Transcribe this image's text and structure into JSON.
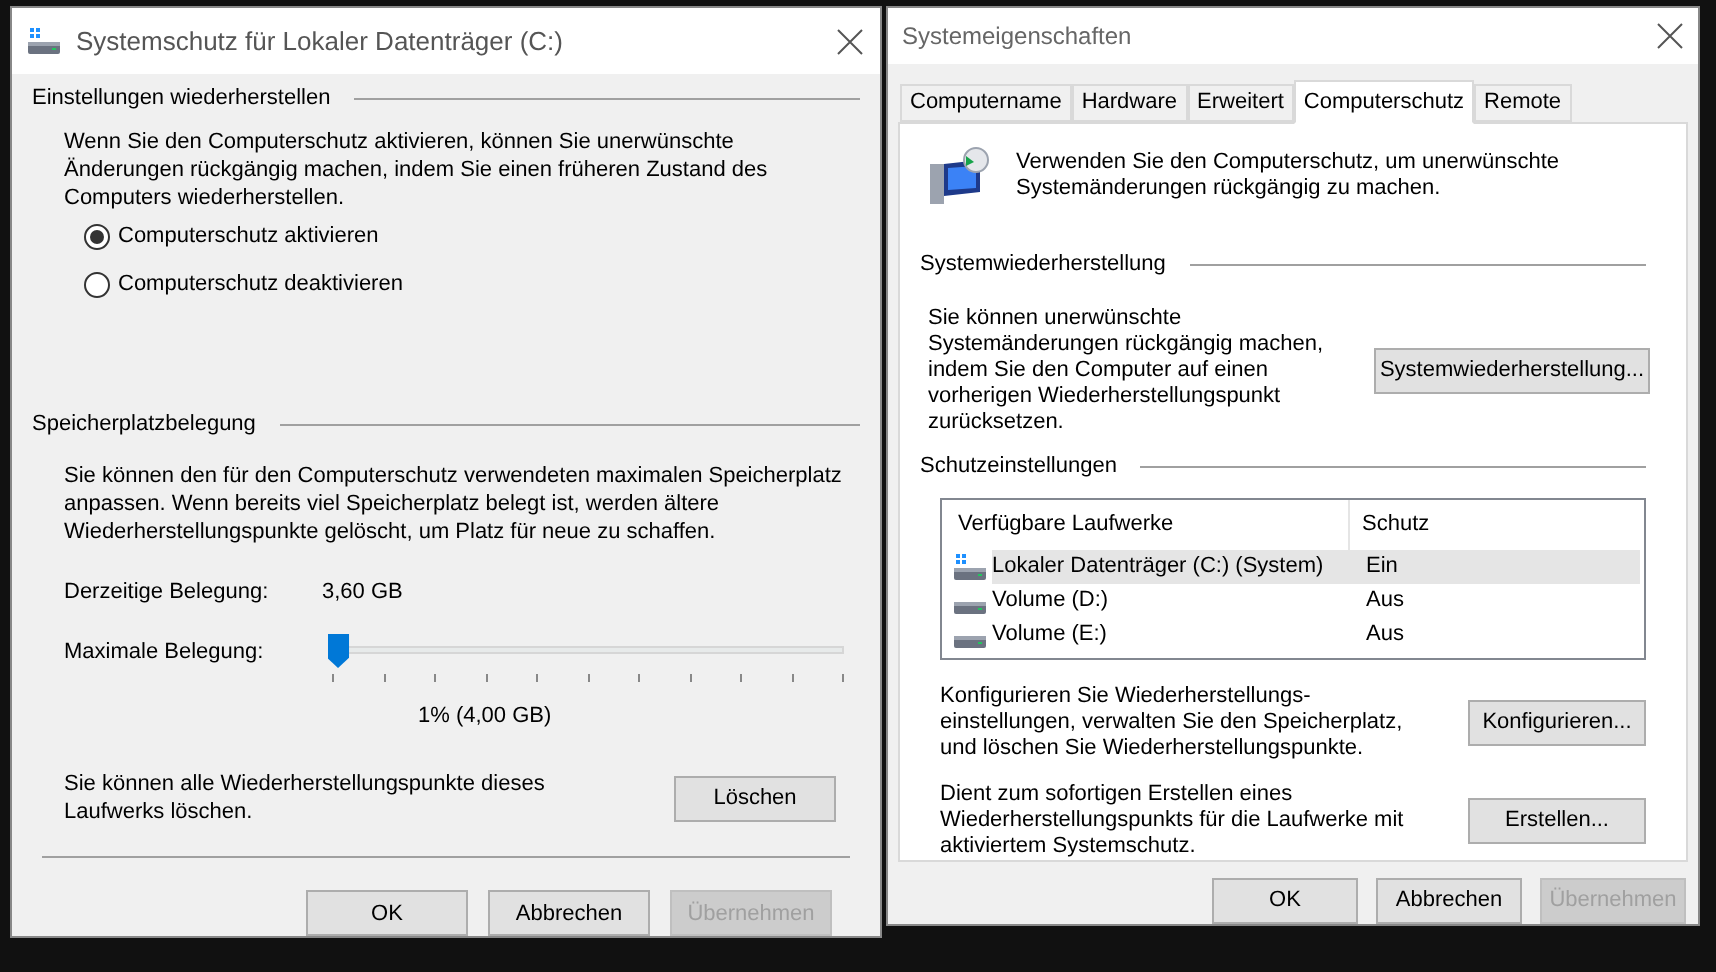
{
  "left_window": {
    "title": "Systemschutz für Lokaler Datenträger (C:)",
    "restore_section": {
      "heading": "Einstellungen wiederherstellen",
      "description": "Wenn Sie den Computerschutz aktivieren, können Sie unerwünschte Änderungen rückgängig machen, indem Sie einen früheren Zustand des Computers wiederherstellen.",
      "options": [
        {
          "label": "Computerschutz aktivieren",
          "selected": true
        },
        {
          "label": "Computerschutz deaktivieren",
          "selected": false
        }
      ]
    },
    "usage_section": {
      "heading": "Speicherplatzbelegung",
      "description": "Sie können den für den Computerschutz verwendeten maximalen Speicherplatz anpassen. Wenn bereits viel Speicherplatz belegt ist, werden ältere Wiederherstellungspunkte gelöscht, um Platz für neue zu schaffen.",
      "current_label": "Derzeitige Belegung:",
      "current_value": "3,60 GB",
      "max_label": "Maximale Belegung:",
      "slider": {
        "level": 0.01
      },
      "slider_reading": "1% (4,00 GB)",
      "delete_text": "Sie können alle Wiederherstellungspunkte dieses Laufwerks löschen.",
      "delete_button": "Löschen"
    },
    "buttons": [
      {
        "label": "OK",
        "disabled": false
      },
      {
        "label": "Abbrechen",
        "disabled": false
      },
      {
        "label": "Übernehmen",
        "disabled": true
      }
    ]
  },
  "right_window": {
    "title": "Systemeigenschaften",
    "tabs": [
      {
        "label": "Computername",
        "selected": false
      },
      {
        "label": "Hardware",
        "selected": false
      },
      {
        "label": "Erweitert",
        "selected": false
      },
      {
        "label": "Computerschutz",
        "selected": true
      },
      {
        "label": "Remote",
        "selected": false
      }
    ],
    "intro": "Verwenden Sie den Computerschutz, um unerwünschte Systemänderungen rückgängig zu machen.",
    "restore_section": {
      "heading": "Systemwiederherstellung",
      "description": "Sie können unerwünschte Systemänderungen rückgängig machen, indem Sie den Computer auf einen vorherigen Wiederherstellungspunkt zurücksetzen.",
      "button": "Systemwiederherstellung..."
    },
    "protection_section": {
      "heading": "Schutzeinstellungen",
      "columns": [
        "Verfügbare Laufwerke",
        "Schutz"
      ],
      "rows": [
        {
          "kind": "system",
          "drive": "Lokaler Datenträger (C:) (System)",
          "protection": "Ein",
          "selected": true
        },
        {
          "kind": "volume",
          "drive": "Volume (D:)",
          "protection": "Aus",
          "selected": false
        },
        {
          "kind": "volume",
          "drive": "Volume (E:)",
          "protection": "Aus",
          "selected": false
        }
      ],
      "configure_text": "Konfigurieren Sie Wiederherstellungs-einstellungen, verwalten Sie den Speicherplatz, und löschen Sie Wiederherstellungspunkte.",
      "configure_button": "Konfigurieren...",
      "create_text": "Dient zum sofortigen Erstellen eines Wiederherstellungspunkts für die Laufwerke mit aktiviertem Systemschutz.",
      "create_button": "Erstellen..."
    },
    "buttons": [
      {
        "label": "OK",
        "disabled": false
      },
      {
        "label": "Abbrechen",
        "disabled": false
      },
      {
        "label": "Übernehmen",
        "disabled": true
      }
    ]
  }
}
